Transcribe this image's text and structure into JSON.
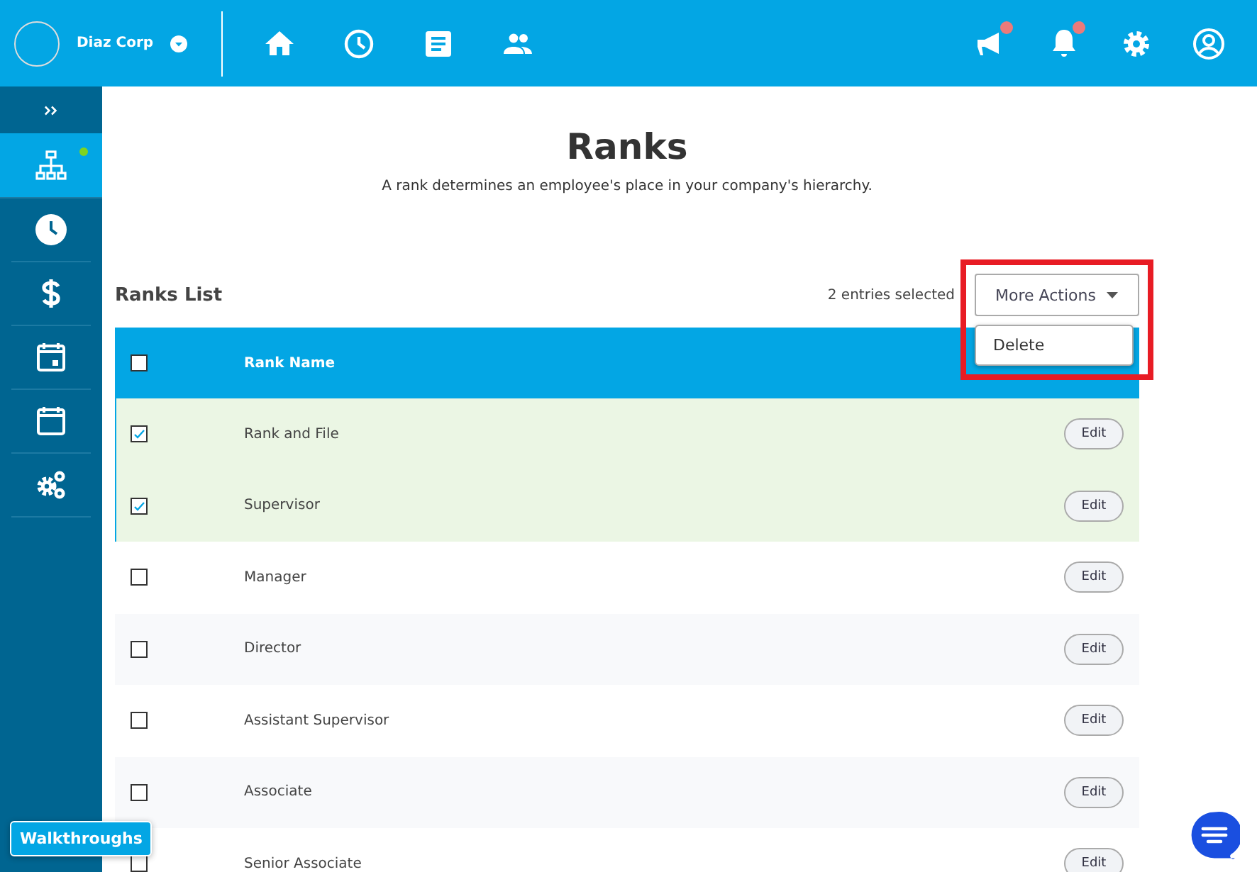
{
  "topbar": {
    "company": "Diaz Corp",
    "nav": [
      {
        "kind": "home"
      },
      {
        "kind": "clock"
      },
      {
        "kind": "document"
      },
      {
        "kind": "people"
      }
    ],
    "actions": [
      {
        "kind": "megaphone",
        "badge": true
      },
      {
        "kind": "bell",
        "badge": true
      },
      {
        "kind": "gear",
        "badge": false
      },
      {
        "kind": "user",
        "badge": false
      }
    ]
  },
  "sidebar": {
    "items": [
      {
        "kind": "org",
        "selected": true,
        "dot": true
      },
      {
        "kind": "clock",
        "selected": false,
        "dot": false
      },
      {
        "kind": "dollar",
        "selected": false,
        "dot": false
      },
      {
        "kind": "calendar-day",
        "selected": false,
        "dot": false
      },
      {
        "kind": "calendar",
        "selected": false,
        "dot": false
      },
      {
        "kind": "gears",
        "selected": false,
        "dot": false
      }
    ],
    "walkthroughs": "Walkthroughs"
  },
  "page": {
    "title": "Ranks",
    "subtitle": "A rank determines an employee's place in your company's hierarchy."
  },
  "list": {
    "title": "Ranks List",
    "selection_count": "2 entries selected",
    "more_actions": "More Actions",
    "menu": [
      "Delete"
    ],
    "header": {
      "checked": false,
      "column": "Rank Name"
    },
    "rows": [
      {
        "name": "Rank and File",
        "checked": true,
        "action": "Edit"
      },
      {
        "name": "Supervisor",
        "checked": true,
        "action": "Edit"
      },
      {
        "name": "Manager",
        "checked": false,
        "action": "Edit"
      },
      {
        "name": "Director",
        "checked": false,
        "action": "Edit"
      },
      {
        "name": "Assistant Supervisor",
        "checked": false,
        "action": "Edit"
      },
      {
        "name": "Associate",
        "checked": false,
        "action": "Edit"
      },
      {
        "name": "Senior Associate",
        "checked": false,
        "action": "Edit"
      }
    ]
  }
}
